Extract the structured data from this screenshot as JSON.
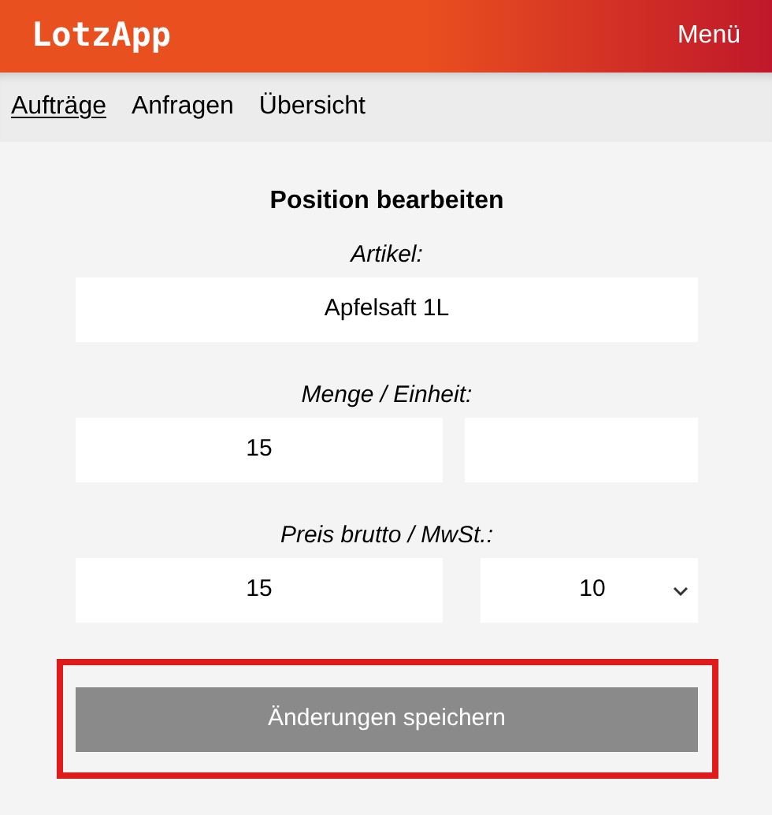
{
  "header": {
    "logo": "LotzApp",
    "menu": "Menü"
  },
  "nav": [
    {
      "label": "Aufträge",
      "selected": true
    },
    {
      "label": "Anfragen",
      "selected": false
    },
    {
      "label": "Übersicht",
      "selected": false
    }
  ],
  "form": {
    "title": "Position bearbeiten",
    "sections": [
      {
        "label": "Artikel:",
        "fields": [
          {
            "kind": "text",
            "value": "Apfelsaft 1L"
          }
        ]
      },
      {
        "label": "Menge / Einheit:",
        "fields": [
          {
            "kind": "text",
            "value": "15"
          },
          {
            "kind": "text"
          }
        ]
      },
      {
        "label": "Preis brutto / MwSt.:",
        "fields": [
          {
            "kind": "text",
            "value": "15"
          },
          {
            "kind": "select",
            "value": "10"
          }
        ]
      }
    ]
  },
  "submit": {
    "label": "Änderungen speichern",
    "highlighted": true
  }
}
